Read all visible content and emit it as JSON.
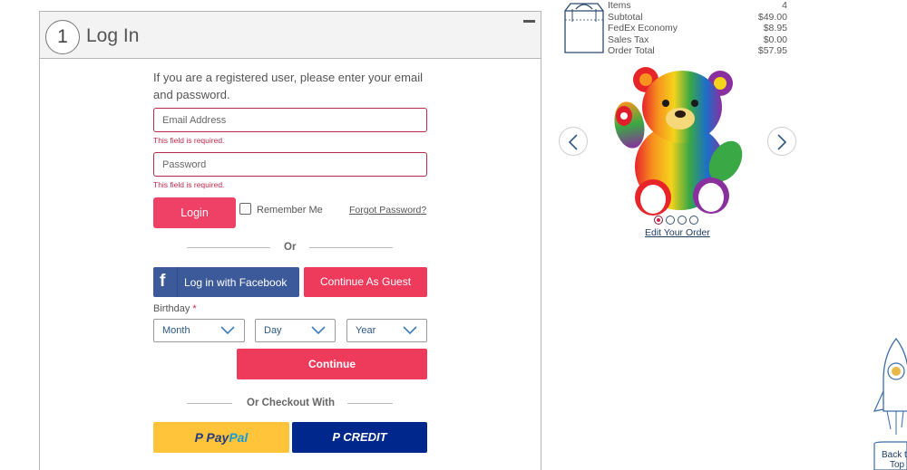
{
  "login": {
    "step_number": "1",
    "title": "Log In",
    "intro": "If you are a registered user, please enter your email and password.",
    "email_placeholder": "Email Address",
    "email_error": "This field is required.",
    "password_placeholder": "Password",
    "password_error": "This field is required.",
    "login_label": "Login",
    "remember_label": "Remember Me",
    "forgot_label": "Forgot Password?",
    "or_label": "Or",
    "facebook_icon": "f",
    "facebook_label": "Log in with Facebook",
    "guest_label": "Continue As Guest",
    "birthday_label": "Birthday",
    "required_mark": "*",
    "month_label": "Month",
    "day_label": "Day",
    "year_label": "Year",
    "continue_label": "Continue",
    "or_checkout_label": "Or Checkout With",
    "paypal_part1": "Pay",
    "paypal_part2": "Pal",
    "paypal_prefix": "P",
    "credit_label": "CREDIT"
  },
  "summary": {
    "rows": [
      {
        "label": "Items",
        "value": "4"
      },
      {
        "label": "Subtotal",
        "value": "$49.00"
      },
      {
        "label": "FedEx Economy",
        "value": "$8.95"
      },
      {
        "label": "Sales Tax",
        "value": "$0.00"
      },
      {
        "label": "Order Total",
        "value": "$57.95"
      }
    ],
    "edit_order_label": "Edit Your Order",
    "carousel_slide_count": 4,
    "carousel_active_index": 0
  },
  "back_to_top": {
    "line1": "Back t",
    "line2": "Top"
  },
  "colors": {
    "accent_pink": "#ee3b5c",
    "error_red": "#c0294e",
    "facebook_blue": "#3c5a9a",
    "paypal_yellow": "#ffc439",
    "credit_navy": "#00288c",
    "link_navy": "#1f3c61"
  },
  "icons": [
    "minus-icon",
    "facebook-icon",
    "chevron-down-icon",
    "paypal-logo",
    "shopping-bag-icon",
    "chevron-left-icon",
    "chevron-right-icon",
    "rocket-icon"
  ]
}
